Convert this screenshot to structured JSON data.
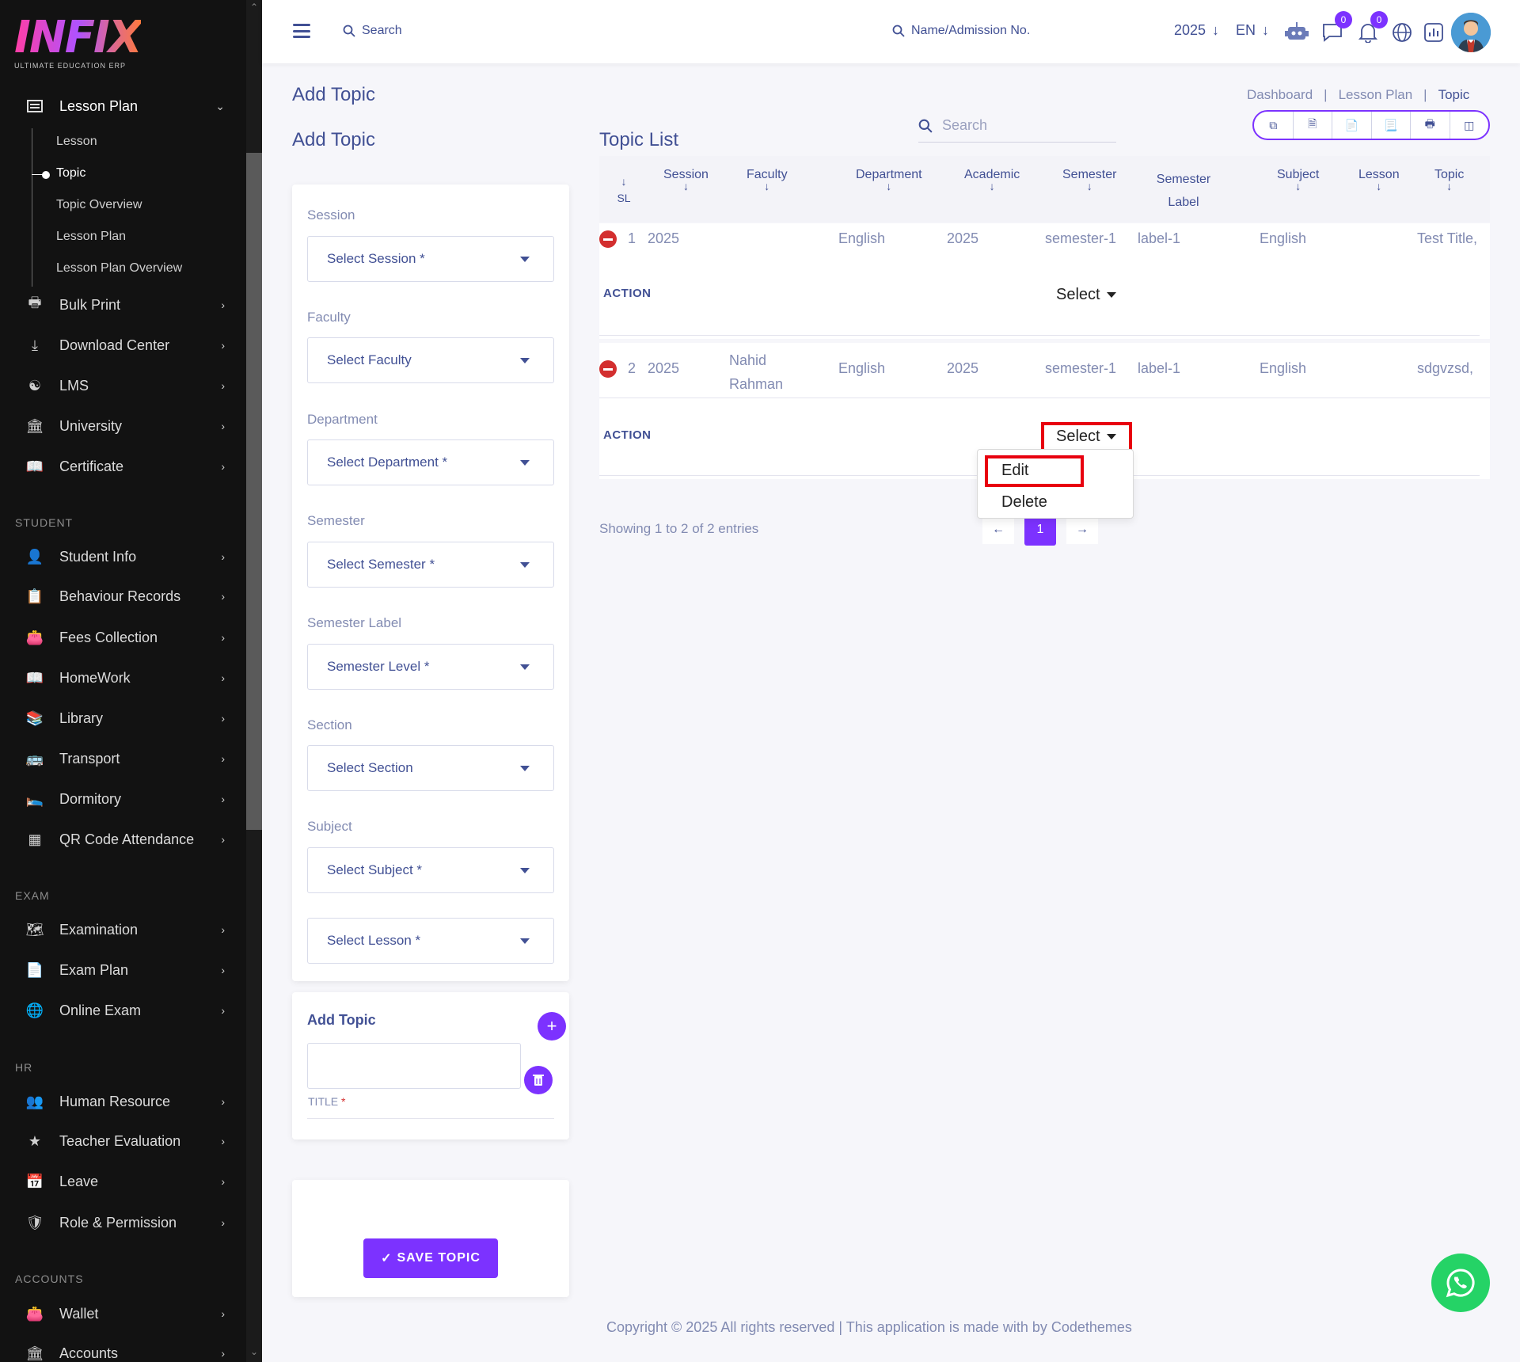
{
  "logo": {
    "mark": "INFIX",
    "sub": "ULTIMATE EDUCATION ERP"
  },
  "sidebar": {
    "lesson_plan": {
      "label": "Lesson Plan",
      "children": [
        "Lesson",
        "Topic",
        "Topic Overview",
        "Lesson Plan",
        "Lesson Plan Overview"
      ]
    },
    "items_top": [
      {
        "label": "Bulk Print",
        "icon": "printer-icon"
      },
      {
        "label": "Download Center",
        "icon": "download-icon"
      },
      {
        "label": "LMS",
        "icon": "lms-icon"
      },
      {
        "label": "University",
        "icon": "bank-icon"
      },
      {
        "label": "Certificate",
        "icon": "book-icon"
      }
    ],
    "section_student": "STUDENT",
    "items_student": [
      {
        "label": "Student Info",
        "icon": "user-icon"
      },
      {
        "label": "Behaviour Records",
        "icon": "records-icon"
      },
      {
        "label": "Fees Collection",
        "icon": "wallet-icon"
      },
      {
        "label": "HomeWork",
        "icon": "book-icon"
      },
      {
        "label": "Library",
        "icon": "library-icon"
      },
      {
        "label": "Transport",
        "icon": "bus-icon"
      },
      {
        "label": "Dormitory",
        "icon": "bed-icon"
      },
      {
        "label": "QR Code Attendance",
        "icon": "qr-icon"
      }
    ],
    "section_exam": "EXAM",
    "items_exam": [
      {
        "label": "Examination",
        "icon": "map-icon"
      },
      {
        "label": "Exam Plan",
        "icon": "document-icon"
      },
      {
        "label": "Online Exam",
        "icon": "globe-icon"
      }
    ],
    "section_hr": "HR",
    "items_hr": [
      {
        "label": "Human Resource",
        "icon": "users-icon"
      },
      {
        "label": "Teacher Evaluation",
        "icon": "star-icon"
      },
      {
        "label": "Leave",
        "icon": "leave-icon"
      },
      {
        "label": "Role & Permission",
        "icon": "shield-icon"
      }
    ],
    "section_accounts": "ACCOUNTS",
    "items_accounts": [
      {
        "label": "Wallet",
        "icon": "wallet-icon"
      },
      {
        "label": "Accounts",
        "icon": "bank-icon"
      }
    ]
  },
  "topbar": {
    "search_label": "Search",
    "admission_search": "Name/Admission No.",
    "year": "2025",
    "lang": "EN",
    "chat_badge": "0",
    "notif_badge": "0"
  },
  "page": {
    "title": "Add Topic",
    "breadcrumb": [
      "Dashboard",
      "Lesson Plan",
      "Topic"
    ]
  },
  "form": {
    "title": "Add Topic",
    "fields": [
      {
        "label": "Session",
        "placeholder": "Select Session *"
      },
      {
        "label": "Faculty",
        "placeholder": "Select Faculty"
      },
      {
        "label": "Department",
        "placeholder": "Select Department *"
      },
      {
        "label": "Semester",
        "placeholder": "Select Semester *"
      },
      {
        "label": "Semester Label",
        "placeholder": "Semester Level *"
      },
      {
        "label": "Section",
        "placeholder": "Select Section"
      },
      {
        "label": "Subject",
        "placeholder": "Select Subject *"
      },
      {
        "label": "",
        "placeholder": "Select Lesson *"
      }
    ],
    "add_topic_heading": "Add Topic",
    "title_label": "TITLE",
    "required_mark": "*",
    "save_label": "SAVE TOPIC"
  },
  "topic_list": {
    "title": "Topic List",
    "search_placeholder": "Search",
    "columns": [
      "SL",
      "Session",
      "Faculty",
      "Department",
      "Academic",
      "Semester",
      "Semester Label",
      "Subject",
      "Lesson",
      "Topic"
    ],
    "rows": [
      {
        "sl": "1",
        "session": "2025",
        "faculty": "",
        "department": "English",
        "academic": "2025",
        "semester": "semester-1",
        "label": "label-1",
        "subject": "English",
        "lesson": "",
        "topic": "Test Title,"
      },
      {
        "sl": "2",
        "session": "2025",
        "faculty": "Nahid Rahman",
        "department": "English",
        "academic": "2025",
        "semester": "semester-1",
        "label": "label-1",
        "subject": "English",
        "lesson": "",
        "topic": "sdgvzsd,"
      }
    ],
    "action_label": "ACTION",
    "select_label": "Select",
    "dropdown": [
      "Edit",
      "Delete"
    ],
    "showing": "Showing 1 to 2 of 2 entries",
    "current_page": "1"
  },
  "footer": "Copyright © 2025 All rights reserved | This application is made with by Codethemes",
  "colors": {
    "accent": "#7c32ff",
    "text": "#415094",
    "muted": "#828bb2",
    "highlight": "#e8000f",
    "whatsapp": "#25d366"
  }
}
